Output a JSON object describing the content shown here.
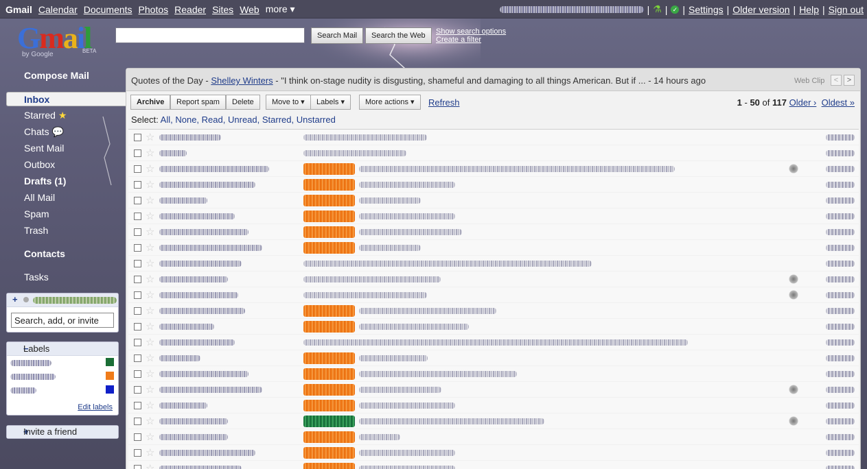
{
  "topnav": {
    "brand": "Gmail",
    "links": [
      "Calendar",
      "Documents",
      "Photos",
      "Reader",
      "Sites",
      "Web",
      "more ▾"
    ],
    "right_links": [
      "Settings",
      "Older version",
      "Help",
      "Sign out"
    ]
  },
  "header": {
    "logo_text": "Gmail",
    "logo_by": "by Google",
    "logo_beta": "BETA",
    "search_placeholder": "",
    "search_mail_label": "Search Mail",
    "search_web_label": "Search the Web",
    "show_search_options": "Show search options",
    "create_filter": "Create a filter"
  },
  "leftnav": {
    "compose": "Compose Mail",
    "inbox": "Inbox",
    "starred": "Starred",
    "chats": "Chats",
    "sent": "Sent Mail",
    "outbox": "Outbox",
    "drafts": "Drafts (1)",
    "all_mail": "All Mail",
    "spam": "Spam",
    "trash": "Trash",
    "contacts": "Contacts",
    "tasks": "Tasks"
  },
  "chat": {
    "input_value": "Search, add, or invite"
  },
  "labels_box": {
    "title": "Labels",
    "colors": [
      "#1b6e36",
      "#f07c1a",
      "#1020c8"
    ],
    "edit_labels": "Edit labels"
  },
  "invite": {
    "label": "Invite a friend"
  },
  "webclip": {
    "prefix": "Quotes of the Day - ",
    "source": "Shelley Winters",
    "text": " - \"I think on-stage nudity is disgusting, shameful and damaging to all things American. But if ... - 14 hours ago",
    "tag": "Web Clip",
    "prev": "<",
    "next": ">"
  },
  "toolbar": {
    "archive": "Archive",
    "report_spam": "Report spam",
    "delete": "Delete",
    "move_to": "Move to ▾",
    "labels": "Labels ▾",
    "more_actions": "More actions ▾",
    "refresh": "Refresh"
  },
  "pager": {
    "start": "1",
    "sep": " - ",
    "end": "50",
    "of": " of ",
    "total": "117",
    "older": "Older ›",
    "oldest": "Oldest »"
  },
  "select": {
    "label": "Select:",
    "options": [
      "All,",
      "None,",
      "Read,",
      "Unread,",
      "Starred,",
      "Unstarred"
    ]
  },
  "messages": [
    {
      "label": null,
      "attachment": false
    },
    {
      "label": null,
      "attachment": false
    },
    {
      "label": "orange",
      "attachment": true
    },
    {
      "label": "orange",
      "attachment": false
    },
    {
      "label": "orange",
      "attachment": false
    },
    {
      "label": "orange",
      "attachment": false
    },
    {
      "label": "orange",
      "attachment": false
    },
    {
      "label": "orange",
      "attachment": false
    },
    {
      "label": null,
      "attachment": false
    },
    {
      "label": null,
      "attachment": true
    },
    {
      "label": null,
      "attachment": true
    },
    {
      "label": "orange",
      "attachment": false
    },
    {
      "label": "orange",
      "attachment": false
    },
    {
      "label": null,
      "attachment": false
    },
    {
      "label": "orange",
      "attachment": false
    },
    {
      "label": "orange",
      "attachment": false
    },
    {
      "label": "orange",
      "attachment": true
    },
    {
      "label": "orange",
      "attachment": false
    },
    {
      "label": "green",
      "attachment": true
    },
    {
      "label": "orange",
      "attachment": false
    },
    {
      "label": "orange",
      "attachment": false
    },
    {
      "label": "orange",
      "attachment": false
    }
  ]
}
